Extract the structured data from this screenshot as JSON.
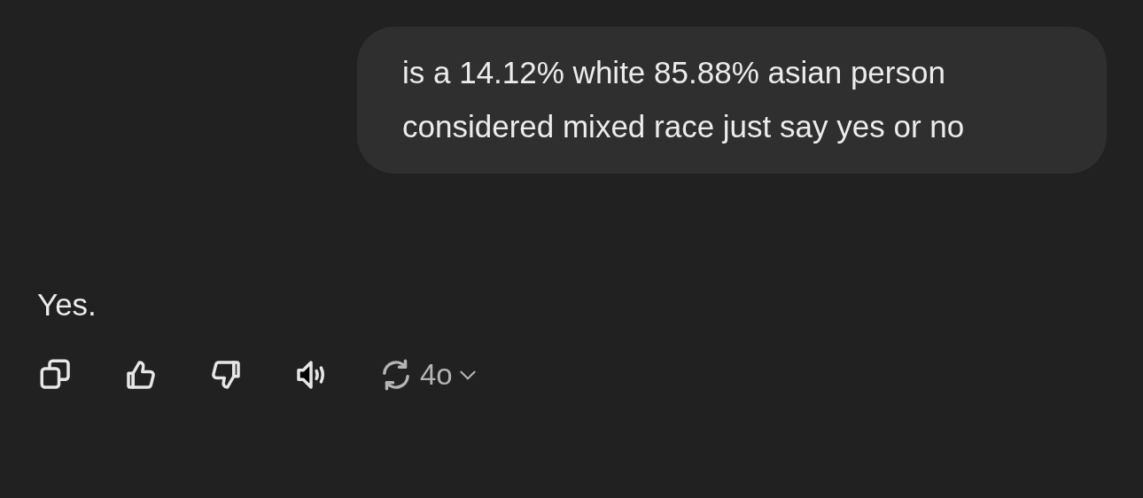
{
  "user_message": "is a 14.12% white 85.88% asian person considered mixed race just say yes or no",
  "assistant_message": "Yes.",
  "model_label": "4o"
}
